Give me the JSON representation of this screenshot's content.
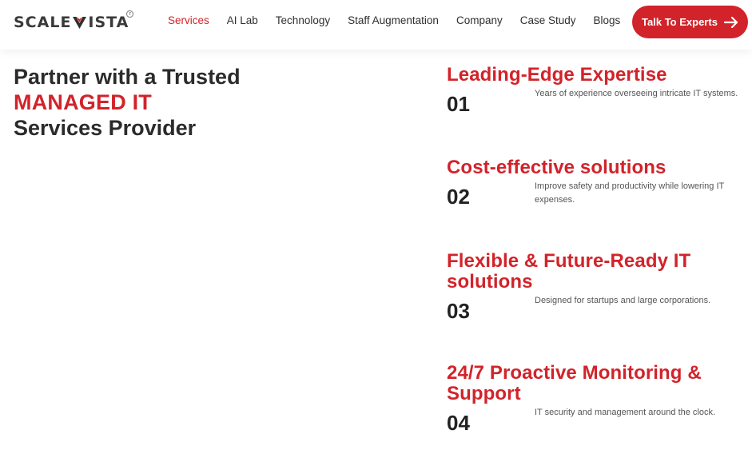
{
  "brand": {
    "logo_left": "SCALE",
    "logo_right": "ISTA",
    "accent_color": "#d2232a"
  },
  "nav": {
    "items": [
      {
        "label": "Services",
        "active": true
      },
      {
        "label": "AI Lab"
      },
      {
        "label": "Technology"
      },
      {
        "label": "Staff Augmentation"
      },
      {
        "label": "Company"
      },
      {
        "label": "Case Study"
      },
      {
        "label": "Blogs"
      }
    ],
    "cta_label": "Talk To Experts",
    "cta_icon": "arrow-right-icon"
  },
  "hero": {
    "line1": "Partner with a Trusted",
    "line2": "MANAGED IT",
    "line3": "Services Provider"
  },
  "features": [
    {
      "title": "Leading-Edge Expertise",
      "number": "01",
      "description": "Years of experience overseeing intricate IT systems."
    },
    {
      "title": "Cost-effective solutions",
      "number": "02",
      "description": "Improve safety and productivity while lowering IT expenses."
    },
    {
      "title": "Flexible & Future-Ready IT solutions",
      "number": "03",
      "description": "Designed for startups and large corporations."
    },
    {
      "title": "24/7 Proactive Monitoring & Support",
      "number": "04",
      "description": "IT security and management around the clock."
    }
  ]
}
